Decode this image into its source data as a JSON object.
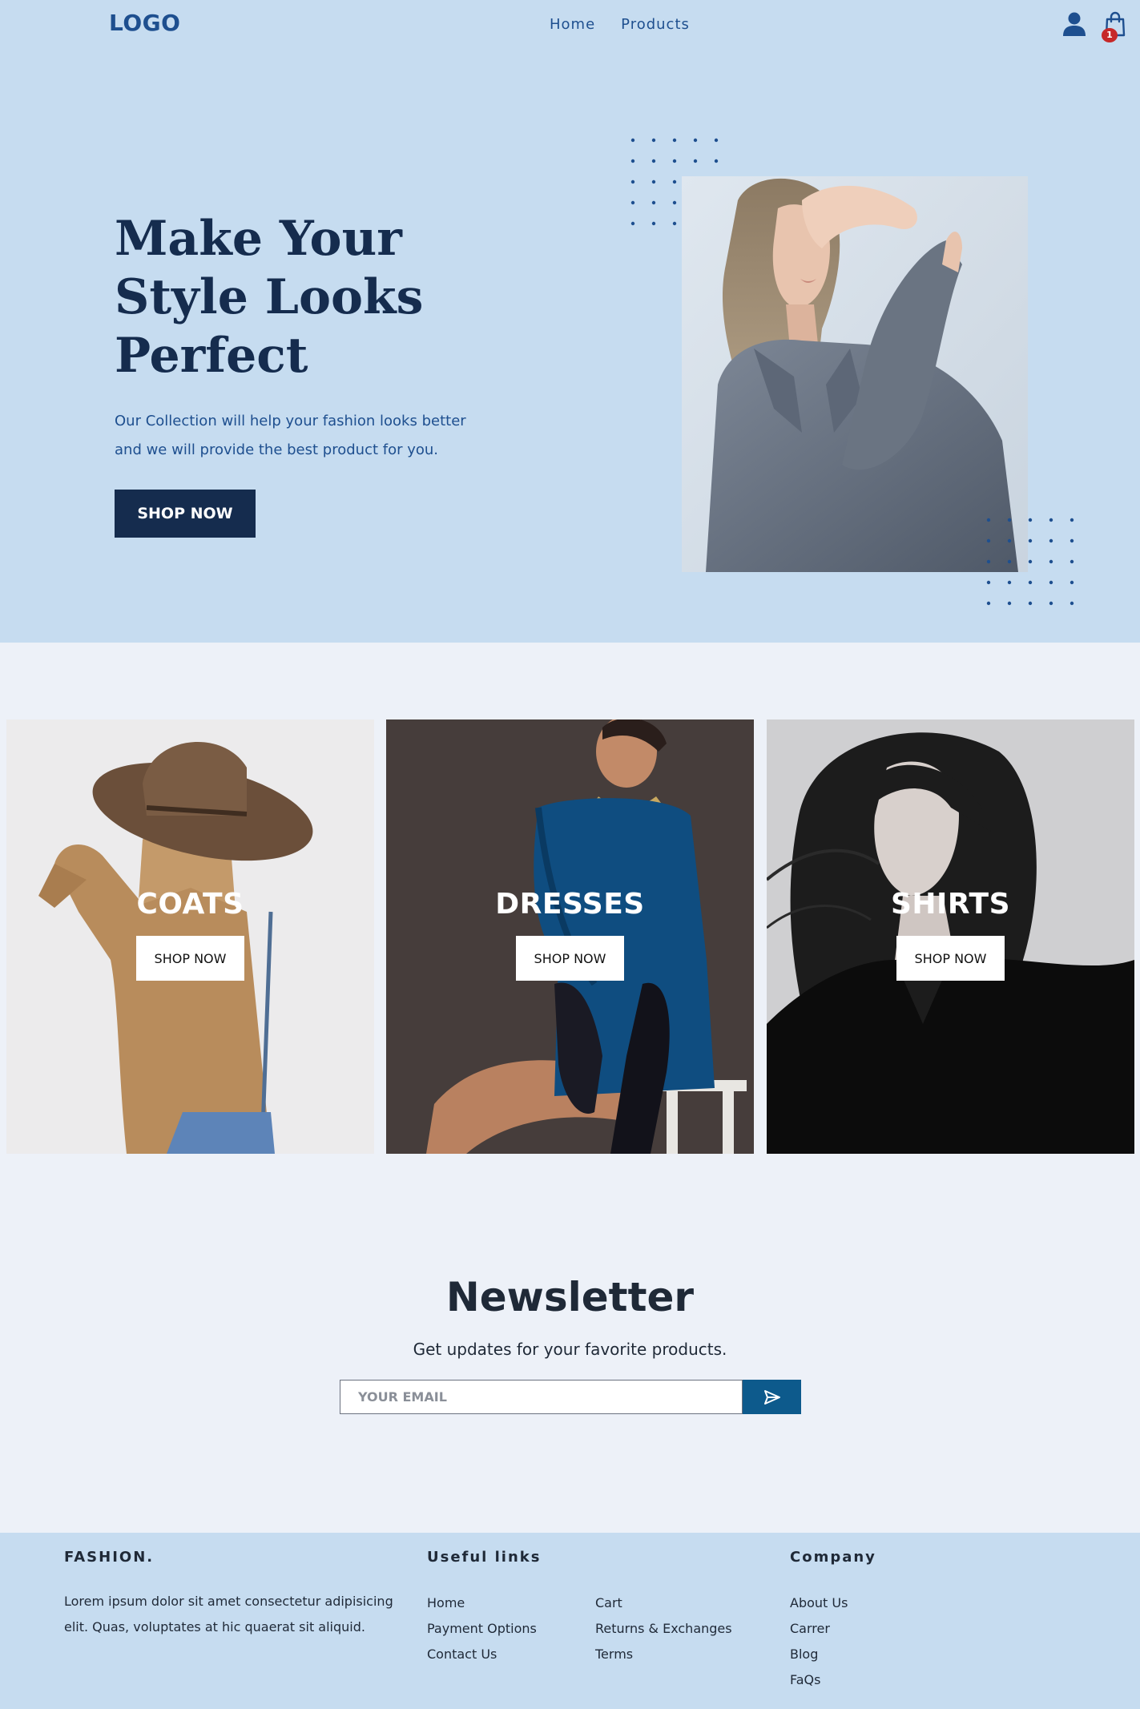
{
  "header": {
    "logo": "LOGO",
    "nav": [
      "Home",
      "Products"
    ],
    "cart_count": "1"
  },
  "hero": {
    "title": "Make Your Style Looks Perfect",
    "subtitle": "Our Collection will help your fashion looks better and we will provide the best product for you.",
    "cta": "SHOP NOW"
  },
  "categories": [
    {
      "title": "COATS",
      "cta": "SHOP NOW"
    },
    {
      "title": "DRESSES",
      "cta": "SHOP NOW"
    },
    {
      "title": "SHIRTS",
      "cta": "SHOP NOW"
    }
  ],
  "newsletter": {
    "title": "Newsletter",
    "subtitle": "Get updates for your favorite products.",
    "placeholder": "YOUR EMAIL"
  },
  "footer": {
    "brand": "FASHION.",
    "description": "Lorem ipsum dolor sit amet consectetur adipisicing elit. Quas, voluptates at hic quaerat sit aliquid.",
    "useful_title": "Useful links",
    "useful_col1": [
      "Home",
      "Payment Options",
      "Contact Us"
    ],
    "useful_col2": [
      "Cart",
      "Returns & Exchanges",
      "Terms"
    ],
    "company_title": "Company",
    "company_links": [
      "About Us",
      "Carrer",
      "Blog",
      "FaQs"
    ]
  },
  "colors": {
    "hero_bg": "#c6dcf0",
    "page_bg": "#edf1f8",
    "primary_dark": "#152c4e",
    "accent_blue": "#1e4f8f",
    "send_button": "#0d5a8c",
    "badge_red": "#c62828"
  },
  "icons": [
    "user-icon",
    "shopping-bag-icon",
    "send-icon"
  ]
}
